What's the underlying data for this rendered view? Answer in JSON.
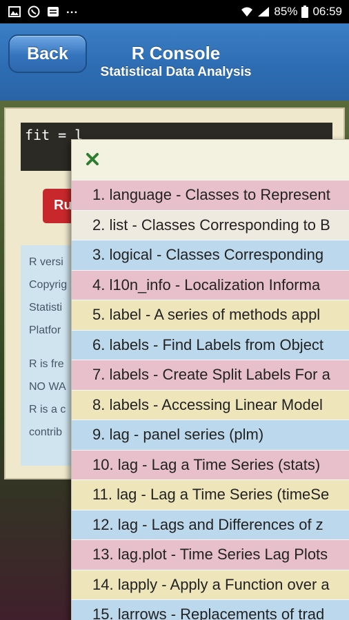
{
  "status_bar": {
    "more": "...",
    "battery": "85%",
    "time": "06:59"
  },
  "header": {
    "back_label": "Back",
    "title": "R Console",
    "subtitle": "Statistical Data Analysis"
  },
  "console": {
    "code": "fit = l",
    "run_label": "Ru",
    "info_lines": [
      "R versi",
      "Copyrig",
      "Statisti",
      "Platfor",
      "R is fre",
      "NO WA",
      "R is a c",
      "contrib"
    ]
  },
  "popup": {
    "items": [
      {
        "label": "1. language - Classes to Represent",
        "color": "#e8c0cb"
      },
      {
        "label": "2. list - Classes Corresponding to B",
        "color": "#eeeae0"
      },
      {
        "label": "3. logical - Classes Corresponding",
        "color": "#bcd8ec"
      },
      {
        "label": "4. l10n_info - Localization Informa",
        "color": "#e8c0cb"
      },
      {
        "label": "5. label - A series of methods appl",
        "color": "#eee5bb"
      },
      {
        "label": "6. labels - Find Labels from Object",
        "color": "#bcd8ec"
      },
      {
        "label": "7. labels - Create Split Labels For a",
        "color": "#e8c0cb"
      },
      {
        "label": "8. labels - Accessing Linear Model",
        "color": "#eee5bb"
      },
      {
        "label": "9. lag - panel series (plm)",
        "color": "#bcd8ec"
      },
      {
        "label": "10. lag - Lag a Time Series (stats)",
        "color": "#e8c0cb"
      },
      {
        "label": "11. lag - Lag a Time Series (timeSe",
        "color": "#eee5bb"
      },
      {
        "label": "12. lag - Lags and Differences of z",
        "color": "#bcd8ec"
      },
      {
        "label": "13. lag.plot - Time Series Lag Plots",
        "color": "#e8c0cb"
      },
      {
        "label": "14. lapply - Apply a Function over a",
        "color": "#eee5bb"
      },
      {
        "label": "15. larrows - Replacements of trad",
        "color": "#bcd8ec"
      }
    ]
  }
}
